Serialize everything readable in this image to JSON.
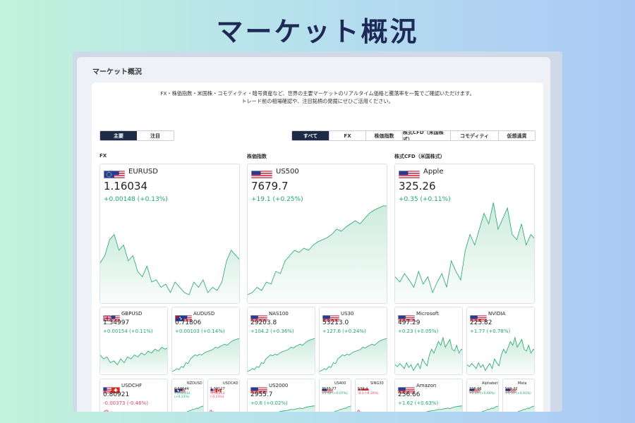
{
  "banner": {
    "title": "マーケット概況"
  },
  "panel": {
    "title": "マーケット概況"
  },
  "intro": {
    "line1": "FX・株価指数・米国株・コモディティ・暗号資産など、世界の主要マーケットのリアルタイム価格と騰落率を一覧でご確認いただけます。",
    "line2": "トレード前の相場確認や、注目銘柄の発掘にぜひご活用ください。"
  },
  "toggle": [
    {
      "label": "主要",
      "active": true
    },
    {
      "label": "注目",
      "active": false
    }
  ],
  "filters": [
    {
      "label": "すべて",
      "active": true
    },
    {
      "label": "FX",
      "active": false
    },
    {
      "label": "株価指数",
      "active": false
    },
    {
      "label": "株式CFD（米国株式）",
      "active": false
    },
    {
      "label": "コモディティ",
      "active": false
    },
    {
      "label": "仮想通貨",
      "active": false
    }
  ],
  "columns": [
    {
      "label": "FX",
      "main": {
        "symbol": "EURUSD",
        "flag": "eu-us",
        "price": "1.16034",
        "change": "+0.00148 (+0.13%)",
        "dir": "up"
      },
      "mid": [
        {
          "symbol": "GBPUSD",
          "flag": "gb-us",
          "price": "1.34997",
          "change": "+0.00154 (+0.11%)",
          "dir": "up"
        },
        {
          "symbol": "AUDUSD",
          "flag": "au-us",
          "price": "0.71806",
          "change": "+0.00103 (+0.14%)",
          "dir": "up"
        }
      ],
      "bottom_big": {
        "symbol": "USDCHF",
        "flag": "us-ch",
        "price": "0.80921",
        "change": "-0.00373 (-0.46%)",
        "dir": "down"
      },
      "bottom_small": [
        {
          "symbol": "NZDUSD",
          "flag": "nz-us",
          "price": "0.58644",
          "change": "+0.00134 (+0.23%)",
          "dir": "up"
        },
        {
          "symbol": "USDCAD",
          "flag": "us-ca",
          "price": "1.38127",
          "change": "-0.00313 (-0.23%)",
          "dir": "down"
        }
      ]
    },
    {
      "label": "株価指数",
      "main": {
        "symbol": "US500",
        "flag": "us",
        "price": "7679.7",
        "change": "+19.1 (+0.25%)",
        "dir": "up"
      },
      "mid": [
        {
          "symbol": "NAS100",
          "flag": "us",
          "price": "29203.8",
          "change": "+104.2 (+0.36%)",
          "dir": "up"
        },
        {
          "symbol": "US30",
          "flag": "us",
          "price": "53213.0",
          "change": "+127.6 (+0.24%)",
          "dir": "up"
        }
      ],
      "bottom_big": {
        "symbol": "US2000",
        "flag": "us",
        "price": "2955.7",
        "change": "+0.6 (+0.02%)",
        "dir": "up"
      },
      "bottom_small": [
        {
          "symbol": "US400",
          "flag": "us",
          "price": "3533.77",
          "change": "+2.42 (+0.07%)",
          "dir": "up"
        },
        {
          "symbol": "SING30",
          "flag": "sg",
          "price": "539.4",
          "change": "-2.1 (-0.39%)",
          "dir": "down"
        }
      ]
    },
    {
      "label": "株式CFD（米国株式）",
      "main": {
        "symbol": "Apple",
        "flag": "us",
        "price": "325.26",
        "change": "+0.35 (+0.11%)",
        "dir": "up"
      },
      "mid": [
        {
          "symbol": "Microsoft",
          "flag": "us",
          "price": "497.29",
          "change": "+0.23 (+0.05%)",
          "dir": "up"
        },
        {
          "symbol": "NVIDIA",
          "flag": "us",
          "price": "225.82",
          "change": "+1.77 (+0.78%)",
          "dir": "up"
        }
      ],
      "bottom_big": {
        "symbol": "Amazon",
        "flag": "us",
        "price": "256.66",
        "change": "+1.62 (+0.63%)",
        "dir": "up"
      },
      "bottom_small": [
        {
          "symbol": "Alphabet",
          "flag": "us",
          "price": "336.96",
          "change": "+2.23 (+0.66%)",
          "dir": "up"
        },
        {
          "symbol": "Meta",
          "flag": "us",
          "price": "599.22",
          "change": "+5.55 (+0.93%)",
          "dir": "up"
        }
      ]
    }
  ],
  "colors": {
    "up": "#1ea66a",
    "down": "#e0445a",
    "active": "#1d2b45",
    "title": "#1c2a55"
  }
}
